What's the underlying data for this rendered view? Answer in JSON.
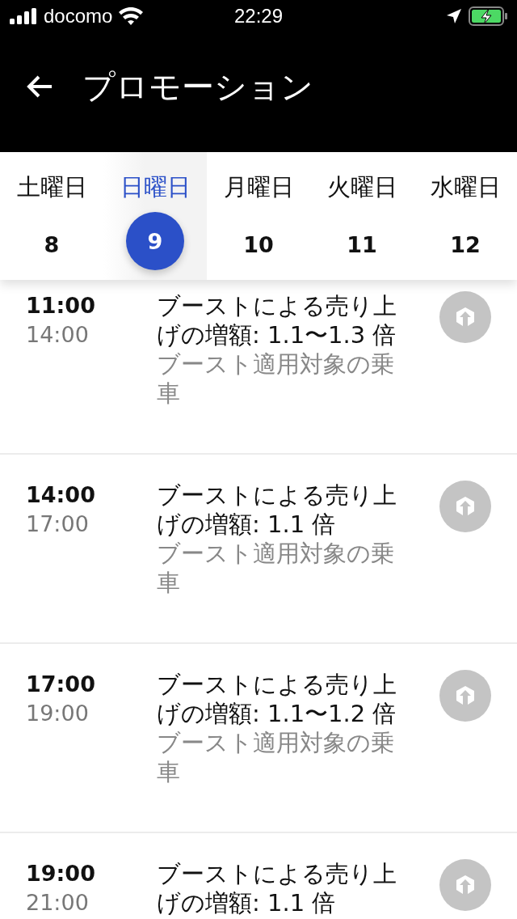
{
  "status_bar": {
    "carrier": "docomo",
    "time": "22:29"
  },
  "header": {
    "title": "プロモーション"
  },
  "days": [
    {
      "weekday": "土曜日",
      "date": "8",
      "selected": false
    },
    {
      "weekday": "日曜日",
      "date": "9",
      "selected": true
    },
    {
      "weekday": "月曜日",
      "date": "10",
      "selected": false
    },
    {
      "weekday": "火曜日",
      "date": "11",
      "selected": false
    },
    {
      "weekday": "水曜日",
      "date": "12",
      "selected": false
    }
  ],
  "promotions": [
    {
      "start": "11:00",
      "end": "14:00",
      "title": "ブーストによる売り上げの増額: 1.1〜1.3 倍",
      "detail": "ブースト適用対象の乗車"
    },
    {
      "start": "14:00",
      "end": "17:00",
      "title": "ブーストによる売り上げの増額: 1.1 倍",
      "detail": "ブースト適用対象の乗車"
    },
    {
      "start": "17:00",
      "end": "19:00",
      "title": "ブーストによる売り上げの増額: 1.1〜1.2 倍",
      "detail": "ブースト適用対象の乗車"
    },
    {
      "start": "19:00",
      "end": "21:00",
      "title": "ブーストによる売り上げの増額: 1.1 倍"
    }
  ]
}
